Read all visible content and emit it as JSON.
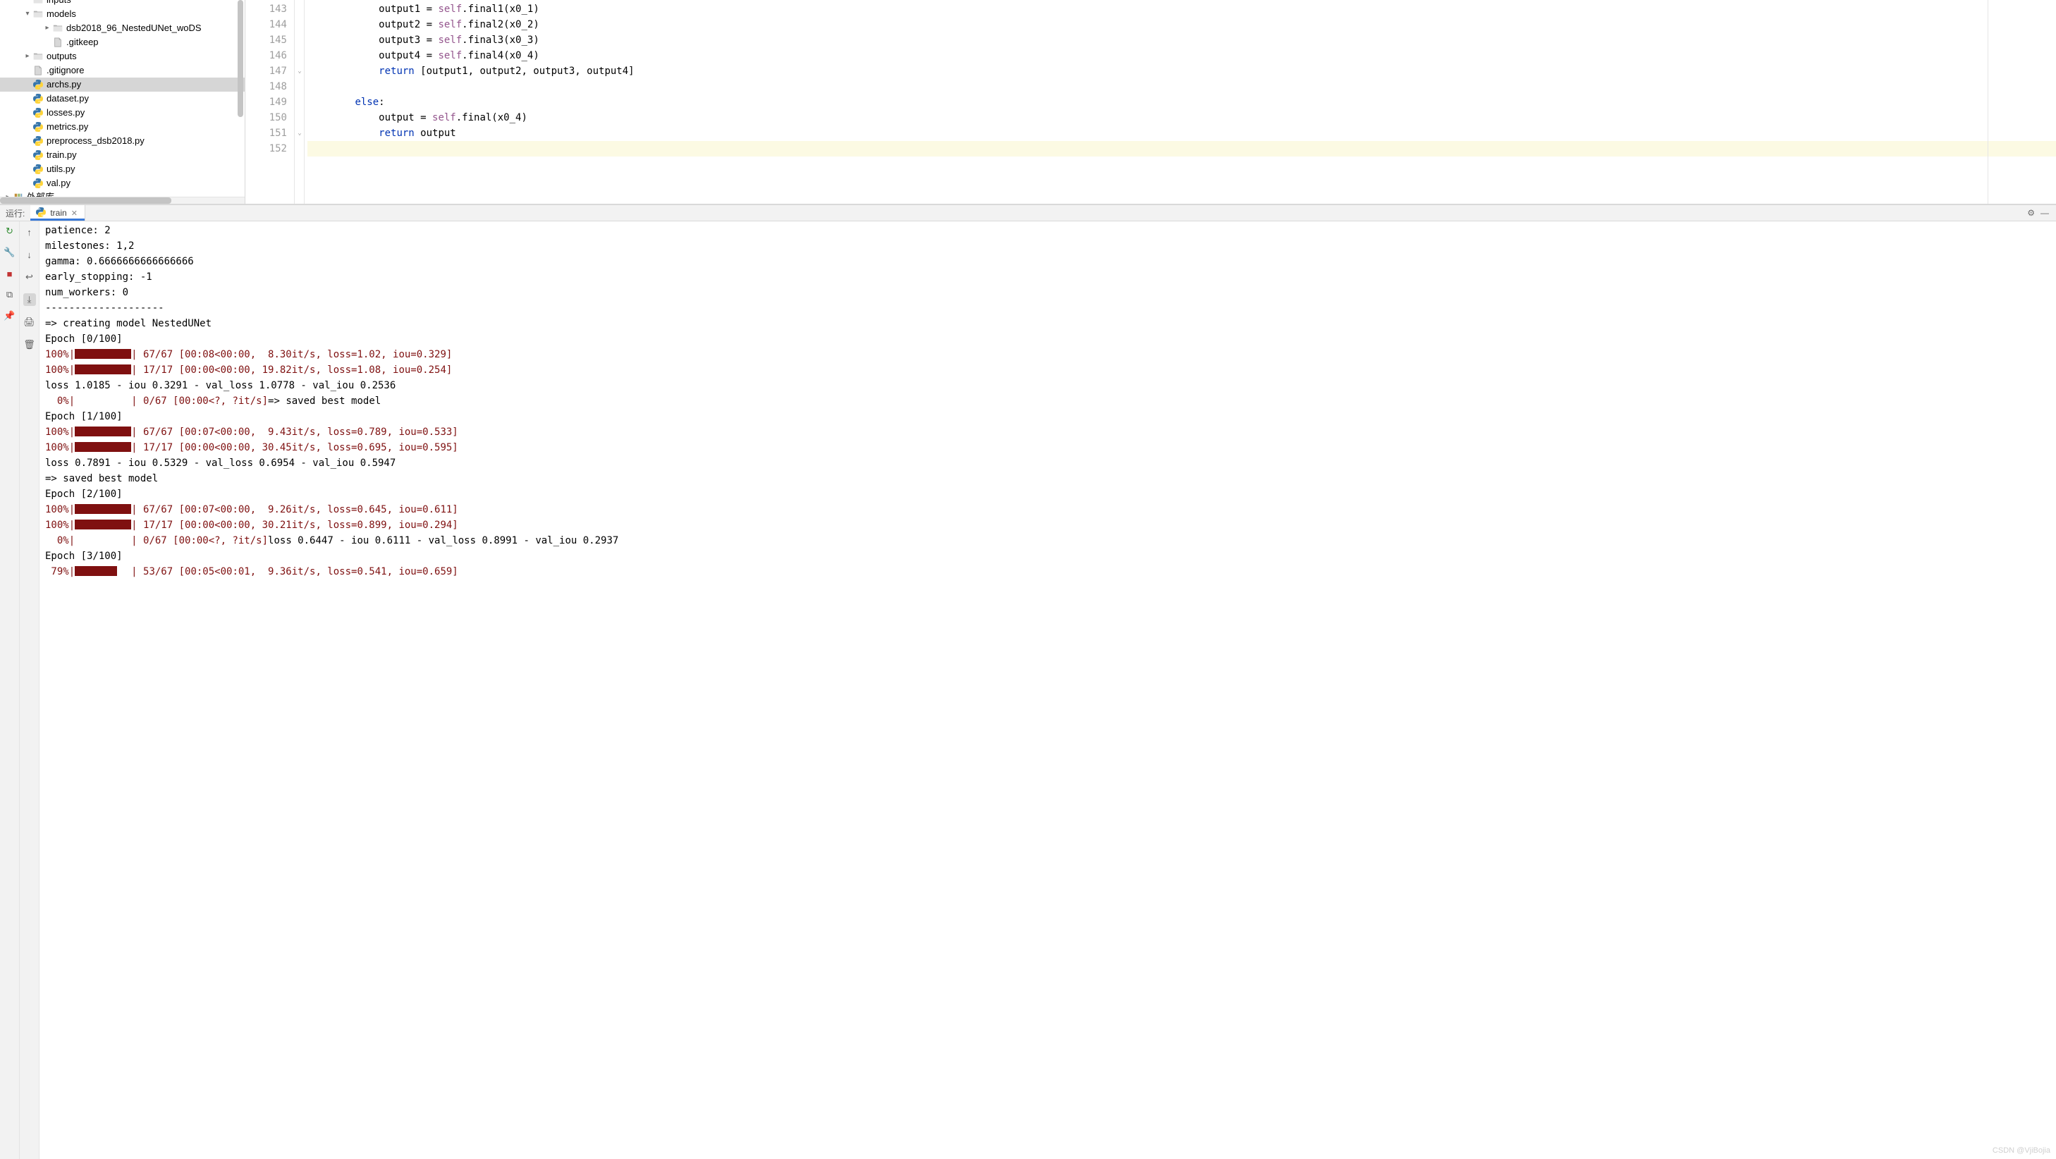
{
  "tree": {
    "items": [
      {
        "label": "inputs",
        "type": "folder-open-dark",
        "indent": 2,
        "arrow": "",
        "halfcut": true
      },
      {
        "label": "models",
        "type": "folder-open",
        "indent": 2,
        "arrow": "▾"
      },
      {
        "label": "dsb2018_96_NestedUNet_woDS",
        "type": "folder",
        "indent": 4,
        "arrow": "▸"
      },
      {
        "label": ".gitkeep",
        "type": "file",
        "indent": 4,
        "arrow": ""
      },
      {
        "label": "outputs",
        "type": "folder",
        "indent": 2,
        "arrow": "▸"
      },
      {
        "label": ".gitignore",
        "type": "file-txt",
        "indent": 2,
        "arrow": ""
      },
      {
        "label": "archs.py",
        "type": "py",
        "indent": 2,
        "arrow": "",
        "selected": true
      },
      {
        "label": "dataset.py",
        "type": "py",
        "indent": 2,
        "arrow": ""
      },
      {
        "label": "losses.py",
        "type": "py",
        "indent": 2,
        "arrow": ""
      },
      {
        "label": "metrics.py",
        "type": "py",
        "indent": 2,
        "arrow": ""
      },
      {
        "label": "preprocess_dsb2018.py",
        "type": "py",
        "indent": 2,
        "arrow": ""
      },
      {
        "label": "train.py",
        "type": "py",
        "indent": 2,
        "arrow": ""
      },
      {
        "label": "utils.py",
        "type": "py",
        "indent": 2,
        "arrow": ""
      },
      {
        "label": "val.py",
        "type": "py",
        "indent": 2,
        "arrow": ""
      },
      {
        "label": "外部库",
        "type": "lib",
        "indent": 0,
        "arrow": "▸",
        "halfcut_bottom": true
      }
    ]
  },
  "editor": {
    "gutter_start": 143,
    "lines": [
      {
        "n": 143,
        "indent": 12,
        "tokens": [
          [
            "plain",
            "output1 = "
          ],
          [
            "self",
            "self"
          ],
          [
            "plain",
            ".final1(x0_1)"
          ]
        ]
      },
      {
        "n": 144,
        "indent": 12,
        "tokens": [
          [
            "plain",
            "output2 = "
          ],
          [
            "self",
            "self"
          ],
          [
            "plain",
            ".final2(x0_2)"
          ]
        ]
      },
      {
        "n": 145,
        "indent": 12,
        "tokens": [
          [
            "plain",
            "output3 = "
          ],
          [
            "self",
            "self"
          ],
          [
            "plain",
            ".final3(x0_3)"
          ]
        ]
      },
      {
        "n": 146,
        "indent": 12,
        "tokens": [
          [
            "plain",
            "output4 = "
          ],
          [
            "self",
            "self"
          ],
          [
            "plain",
            ".final4(x0_4)"
          ]
        ]
      },
      {
        "n": 147,
        "indent": 12,
        "tokens": [
          [
            "kw",
            "return"
          ],
          [
            "plain",
            " [output1, output2, output3, output4]"
          ]
        ]
      },
      {
        "n": 148,
        "indent": 0,
        "tokens": []
      },
      {
        "n": 149,
        "indent": 8,
        "tokens": [
          [
            "kw",
            "else"
          ],
          [
            "plain",
            ":"
          ]
        ]
      },
      {
        "n": 150,
        "indent": 12,
        "tokens": [
          [
            "plain",
            "output = "
          ],
          [
            "self",
            "self"
          ],
          [
            "plain",
            ".final(x0_4)"
          ]
        ]
      },
      {
        "n": 151,
        "indent": 12,
        "tokens": [
          [
            "kw",
            "return"
          ],
          [
            "plain",
            " output"
          ]
        ]
      },
      {
        "n": 152,
        "indent": 0,
        "tokens": [],
        "hl": true
      }
    ],
    "fold_marks": [
      {
        "line": 147
      },
      {
        "line": 151
      }
    ]
  },
  "run": {
    "header_label": "运行:",
    "tab_name": "train",
    "gear_title": "",
    "minimize_title": ""
  },
  "console": {
    "lines": [
      {
        "plain": "patience: 2"
      },
      {
        "plain": "milestones: 1,2"
      },
      {
        "plain": "gamma: 0.6666666666666666"
      },
      {
        "plain": "early_stopping: -1"
      },
      {
        "plain": "num_workers: 0"
      },
      {
        "plain": "--------------------"
      },
      {
        "plain": "=> creating model NestedUNet"
      },
      {
        "plain": "Epoch [0/100]"
      },
      {
        "progress": {
          "pct": "100%",
          "bar": "full",
          "tail": "| 67/67 [00:08<00:00,  8.30it/s, loss=1.02, iou=0.329]"
        }
      },
      {
        "progress": {
          "pct": "100%",
          "bar": "full",
          "tail": "| 17/17 [00:00<00:00, 19.82it/s, loss=1.08, iou=0.254]"
        }
      },
      {
        "plain": "loss 1.0185 - iou 0.3291 - val_loss 1.0778 - val_iou 0.2536"
      },
      {
        "progress": {
          "pct": "  0%",
          "bar": "empty",
          "tail": "| 0/67 [00:00<?, ?it/s]",
          "after_plain": "=> saved best model"
        }
      },
      {
        "plain": "Epoch [1/100]"
      },
      {
        "progress": {
          "pct": "100%",
          "bar": "full",
          "tail": "| 67/67 [00:07<00:00,  9.43it/s, loss=0.789, iou=0.533]"
        }
      },
      {
        "progress": {
          "pct": "100%",
          "bar": "full",
          "tail": "| 17/17 [00:00<00:00, 30.45it/s, loss=0.695, iou=0.595]"
        }
      },
      {
        "plain": "loss 0.7891 - iou 0.5329 - val_loss 0.6954 - val_iou 0.5947"
      },
      {
        "plain": "=> saved best model"
      },
      {
        "plain": "Epoch [2/100]"
      },
      {
        "progress": {
          "pct": "100%",
          "bar": "full",
          "tail": "| 67/67 [00:07<00:00,  9.26it/s, loss=0.645, iou=0.611]"
        }
      },
      {
        "progress": {
          "pct": "100%",
          "bar": "full",
          "tail": "| 17/17 [00:00<00:00, 30.21it/s, loss=0.899, iou=0.294]"
        }
      },
      {
        "progress": {
          "pct": "  0%",
          "bar": "empty",
          "tail": "| 0/67 [00:00<?, ?it/s]",
          "after_plain": "loss 0.6447 - iou 0.6111 - val_loss 0.8991 - val_iou 0.2937"
        }
      },
      {
        "plain": "Epoch [3/100]"
      },
      {
        "progress": {
          "pct": " 79%",
          "bar": "short",
          "tail": "| 53/67 [00:05<00:01,  9.36it/s, loss=0.541, iou=0.659]"
        }
      }
    ]
  },
  "watermark": "CSDN @VjiBojia"
}
